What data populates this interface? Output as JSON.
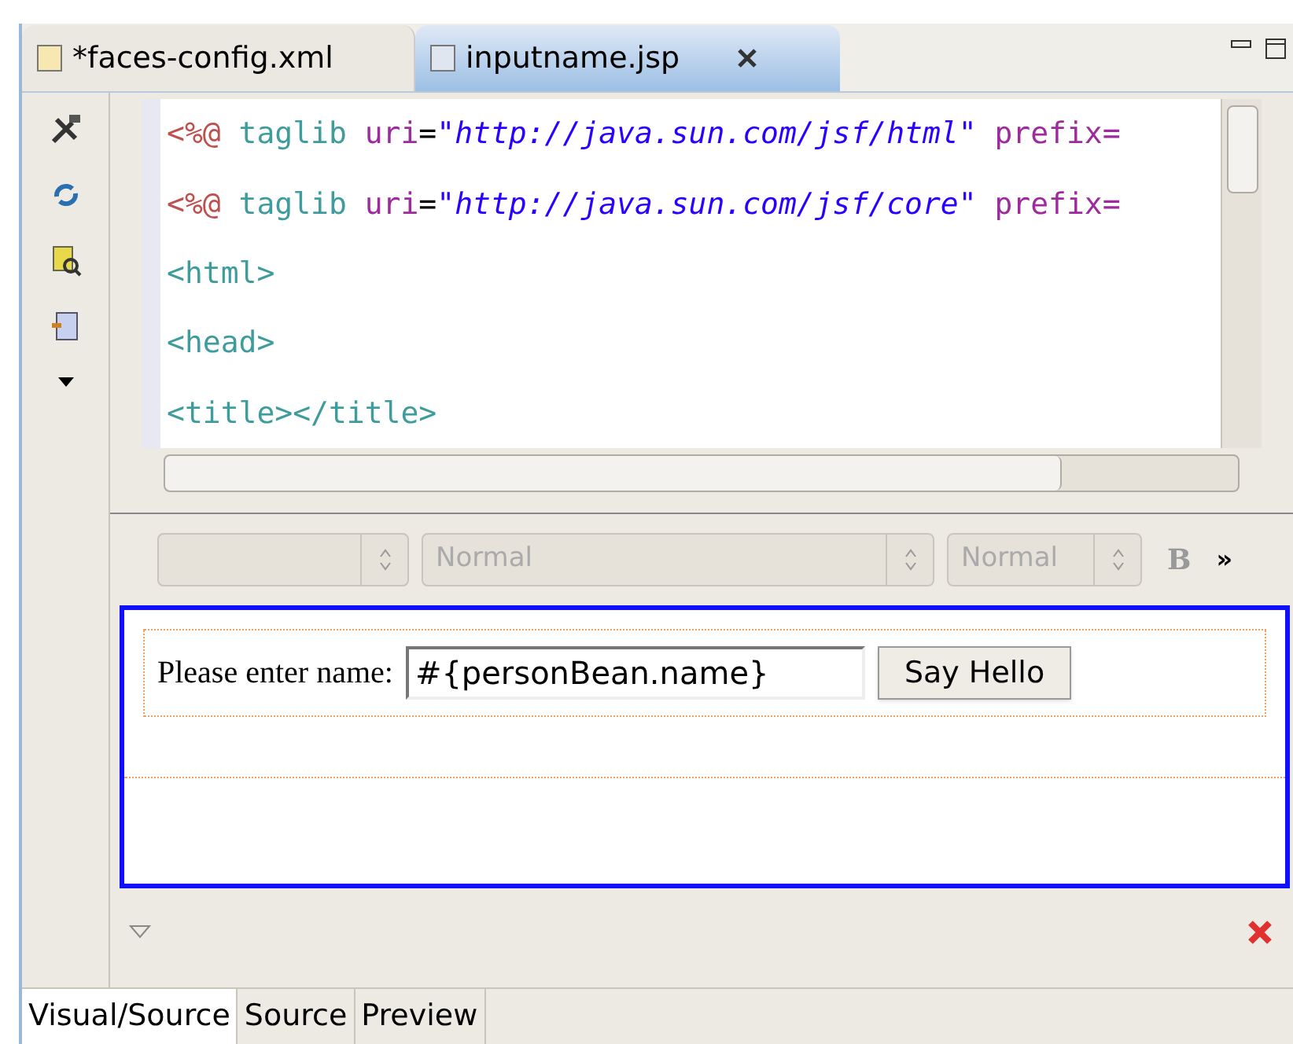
{
  "editor_tabs": [
    {
      "label": "*faces-config.xml",
      "selected": false
    },
    {
      "label": "inputname.jsp",
      "selected": true
    }
  ],
  "source_lines": [
    [
      {
        "kind": "delim",
        "text": "<%@"
      },
      {
        "kind": "tag",
        "text": " taglib "
      },
      {
        "kind": "attr",
        "text": "uri"
      },
      {
        "kind": "plain",
        "text": "="
      },
      {
        "kind": "string",
        "text": "\"http://java.sun.com/jsf/html\""
      },
      {
        "kind": "attr",
        "text": " prefix="
      }
    ],
    [
      {
        "kind": "delim",
        "text": "<%@"
      },
      {
        "kind": "tag",
        "text": " taglib "
      },
      {
        "kind": "attr",
        "text": "uri"
      },
      {
        "kind": "plain",
        "text": "="
      },
      {
        "kind": "string",
        "text": "\"http://java.sun.com/jsf/core\""
      },
      {
        "kind": "attr",
        "text": " prefix="
      }
    ],
    [
      {
        "kind": "tag",
        "text": "<html>"
      }
    ],
    [
      {
        "kind": "tag",
        "text": "<head>"
      }
    ],
    [
      {
        "kind": "tag",
        "text": "<title></title>"
      }
    ]
  ],
  "format_toolbar": {
    "font_style": "Normal",
    "font_size": "Normal",
    "bold": "B",
    "more": "»"
  },
  "preview": {
    "label": "Please enter name:",
    "input_value": "#{personBean.name}",
    "button": "Say Hello"
  },
  "bottom_tabs": [
    {
      "label": "Visual/Source",
      "selected": true
    },
    {
      "label": "Source",
      "selected": false
    },
    {
      "label": "Preview",
      "selected": false
    }
  ]
}
